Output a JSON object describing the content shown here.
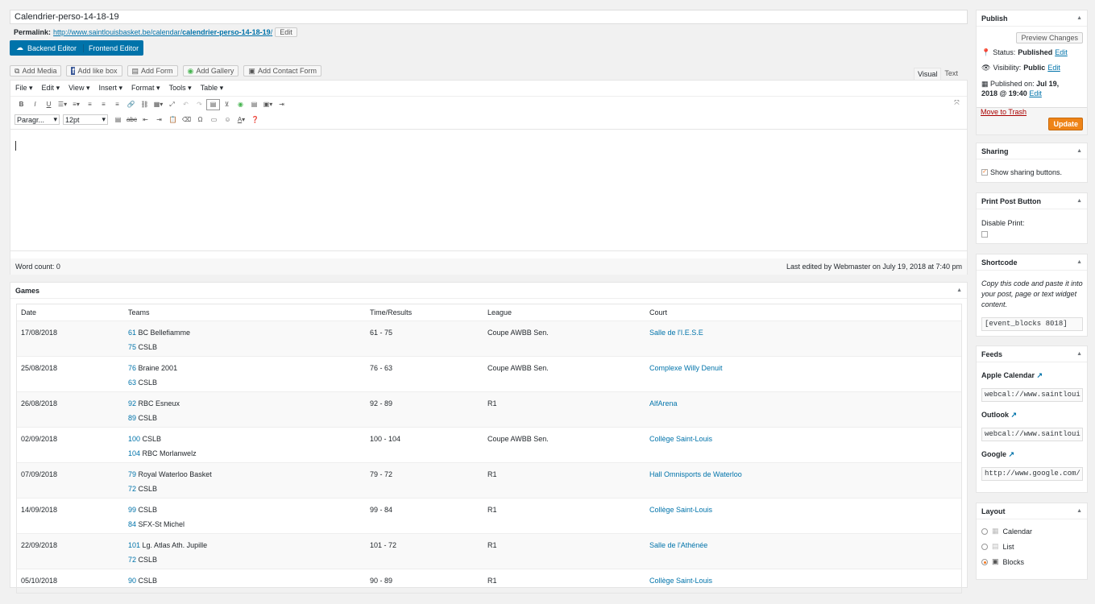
{
  "title_value": "Calendrier-perso-14-18-19",
  "permalink": {
    "label": "Permalink:",
    "url_base": "http://www.saintlouisbasket.be/calendar/",
    "url_slug": "calendrier-perso-14-18-19",
    "url_tail": "/",
    "edit": "Edit"
  },
  "editor_switch": {
    "backend": "Backend Editor",
    "frontend": "Frontend Editor"
  },
  "media_buttons": [
    "Add Media",
    "Add like box",
    "Add Form",
    "Add Gallery",
    "Add Contact Form"
  ],
  "editor_tabs": {
    "visual": "Visual",
    "text": "Text"
  },
  "menu": [
    "File",
    "Edit",
    "View",
    "Insert",
    "Format",
    "Tools",
    "Table"
  ],
  "format_select": "Paragr...",
  "size_select": "12pt",
  "status_bar": {
    "word_count": "Word count: 0",
    "last_edited": "Last edited by Webmaster on July 19, 2018 at 7:40 pm"
  },
  "games": {
    "title": "Games",
    "headers": [
      "Date",
      "Teams",
      "Time/Results",
      "League",
      "Court"
    ],
    "rows": [
      {
        "date": "17/08/2018",
        "s1": "61",
        "t1": "BC Bellefiamme",
        "s2": "75",
        "t2": "CSLB",
        "result": "61 - 75",
        "league": "Coupe AWBB Sen.",
        "court": "Salle de l'I.E.S.E"
      },
      {
        "date": "25/08/2018",
        "s1": "76",
        "t1": "Braine 2001",
        "s2": "63",
        "t2": "CSLB",
        "result": "76 - 63",
        "league": "Coupe AWBB Sen.",
        "court": "Complexe Willy Denuit"
      },
      {
        "date": "26/08/2018",
        "s1": "92",
        "t1": "RBC Esneux",
        "s2": "89",
        "t2": "CSLB",
        "result": "92 - 89",
        "league": "R1",
        "court": "AlfArena"
      },
      {
        "date": "02/09/2018",
        "s1": "100",
        "t1": "CSLB",
        "s2": "104",
        "t2": "RBC Morlanwelz",
        "result": "100 - 104",
        "league": "Coupe AWBB Sen.",
        "court": "Collège Saint-Louis"
      },
      {
        "date": "07/09/2018",
        "s1": "79",
        "t1": "Royal Waterloo Basket",
        "s2": "72",
        "t2": "CSLB",
        "result": "79 - 72",
        "league": "R1",
        "court": "Hall Omnisports de Waterloo"
      },
      {
        "date": "14/09/2018",
        "s1": "99",
        "t1": "CSLB",
        "s2": "84",
        "t2": "SFX-St Michel",
        "result": "99 - 84",
        "league": "R1",
        "court": "Collège Saint-Louis"
      },
      {
        "date": "22/09/2018",
        "s1": "101",
        "t1": "Lg. Atlas Ath. Jupille",
        "s2": "72",
        "t2": "CSLB",
        "result": "101 - 72",
        "league": "R1",
        "court": "Salle de l'Athénée"
      },
      {
        "date": "05/10/2018",
        "s1": "90",
        "t1": "CSLB",
        "s2": "",
        "t2": "",
        "result": "90 - 89",
        "league": "R1",
        "court": "Collège Saint-Louis"
      }
    ]
  },
  "publish": {
    "title": "Publish",
    "preview": "Preview Changes",
    "status_label": "Status:",
    "status_value": "Published",
    "status_edit": "Edit",
    "visibility_label": "Visibility:",
    "visibility_value": "Public",
    "visibility_edit": "Edit",
    "published_label": "Published on:",
    "published_value1": "Jul 19,",
    "published_value2": "2018 @ 19:40",
    "published_edit": "Edit",
    "trash": "Move to Trash",
    "update": "Update"
  },
  "sharing": {
    "title": "Sharing",
    "checkbox_label": "Show sharing buttons."
  },
  "print_button": {
    "title": "Print Post Button",
    "label": "Disable Print:"
  },
  "shortcode": {
    "title": "Shortcode",
    "description": "Copy this code and paste it into your post, page or text widget content.",
    "value": "[event_blocks 8018]"
  },
  "feeds": {
    "title": "Feeds",
    "items": [
      {
        "label": "Apple Calendar",
        "value": "webcal://www.saintloui"
      },
      {
        "label": "Outlook",
        "value": "webcal://www.saintloui"
      },
      {
        "label": "Google",
        "value": "http://www.google.com/"
      }
    ]
  },
  "layout": {
    "title": "Layout",
    "options": [
      "Calendar",
      "List",
      "Blocks"
    ],
    "selected": "Blocks"
  }
}
